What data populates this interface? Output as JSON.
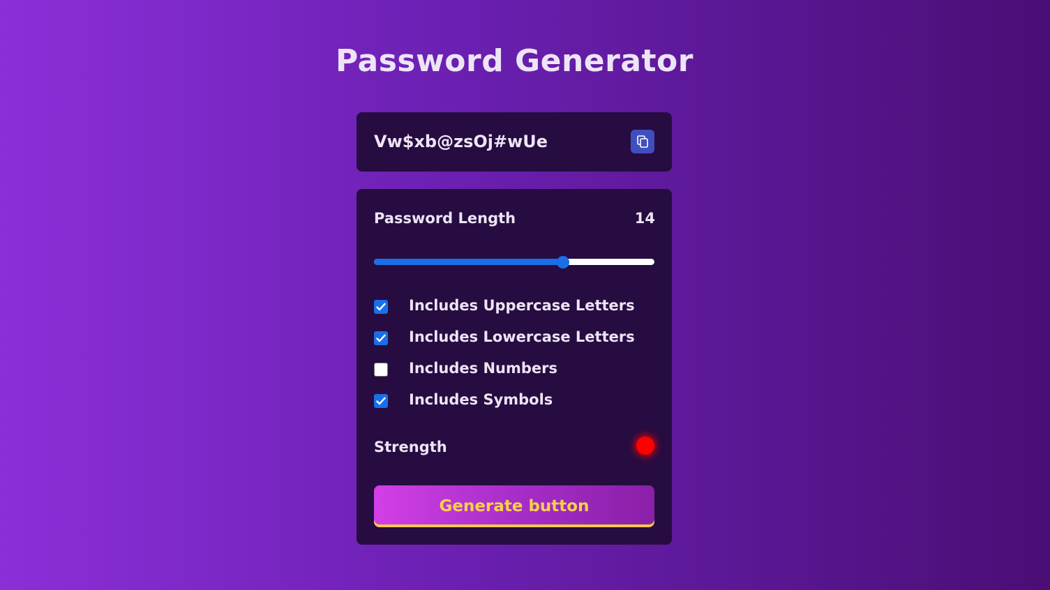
{
  "page": {
    "title": "Password Generator"
  },
  "display": {
    "password": "Vw$xb@zsOj#wUe",
    "copy_icon": "copy-icon"
  },
  "settings": {
    "length_label": "Password Length",
    "length_value": "14",
    "slider_fill_fraction": 0.675,
    "options": [
      {
        "label": "Includes Uppercase Letters",
        "checked": true
      },
      {
        "label": "Includes Lowercase Letters",
        "checked": true
      },
      {
        "label": "Includes Numbers",
        "checked": false
      },
      {
        "label": "Includes Symbols",
        "checked": true
      }
    ],
    "strength_label": "Strength",
    "strength_color": "#ff0000",
    "generate_label": "Generate button"
  },
  "colors": {
    "card_background": "#260c40",
    "accent_blue": "#1a6fe8",
    "button_text": "#f7d14a"
  }
}
